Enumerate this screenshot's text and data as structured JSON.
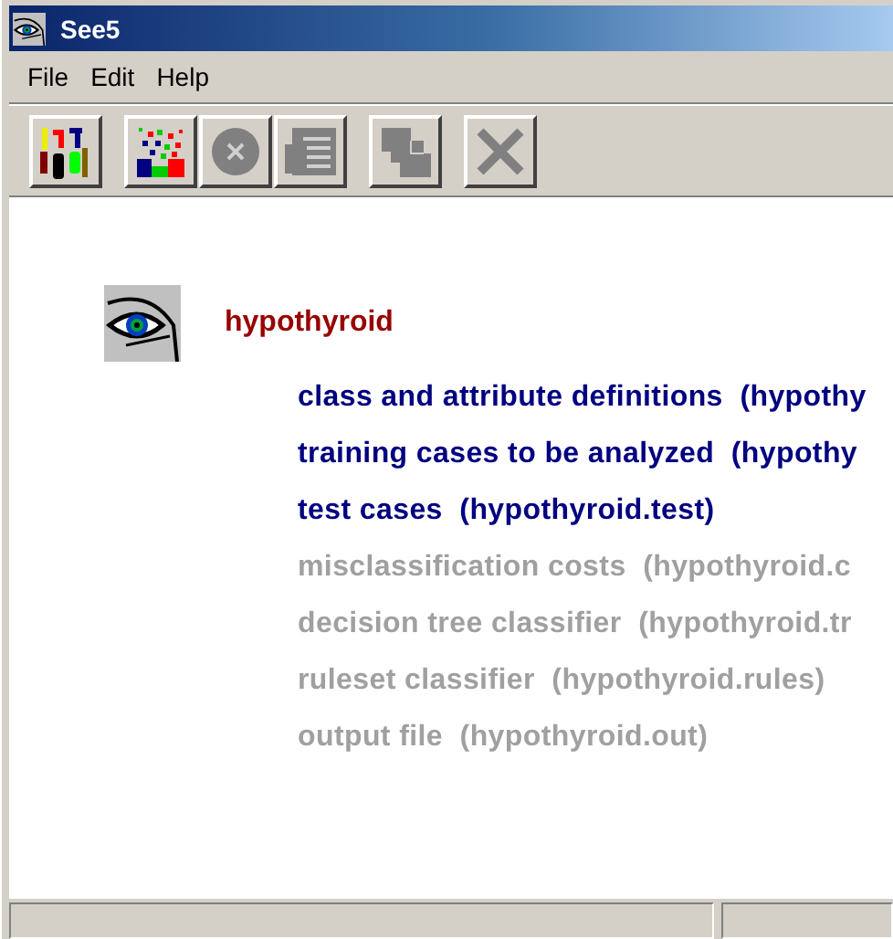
{
  "window": {
    "title": "See5"
  },
  "menu": [
    "File",
    "Edit",
    "Help"
  ],
  "toolbar": [
    [
      {
        "kind": "data",
        "disabled": false
      }
    ],
    [
      {
        "kind": "construct",
        "disabled": false
      },
      {
        "kind": "stop",
        "disabled": true
      },
      {
        "kind": "review",
        "disabled": true
      }
    ],
    [
      {
        "kind": "cross-reference",
        "disabled": true
      }
    ],
    [
      {
        "kind": "cancel",
        "disabled": true
      }
    ]
  ],
  "application": {
    "name": "hypothyroid"
  },
  "files": [
    {
      "label": "class and attribute definitions  (hypothy",
      "available": true
    },
    {
      "label": "training cases to be analyzed  (hypothy",
      "available": true
    },
    {
      "label": "test cases  (hypothyroid.test)",
      "available": true
    },
    {
      "label": "misclassification costs  (hypothyroid.c",
      "available": false
    },
    {
      "label": "decision tree classifier  (hypothyroid.tr",
      "available": false
    },
    {
      "label": "ruleset classifier  (hypothyroid.rules)",
      "available": false
    },
    {
      "label": "output file  (hypothyroid.out)",
      "available": false
    }
  ]
}
